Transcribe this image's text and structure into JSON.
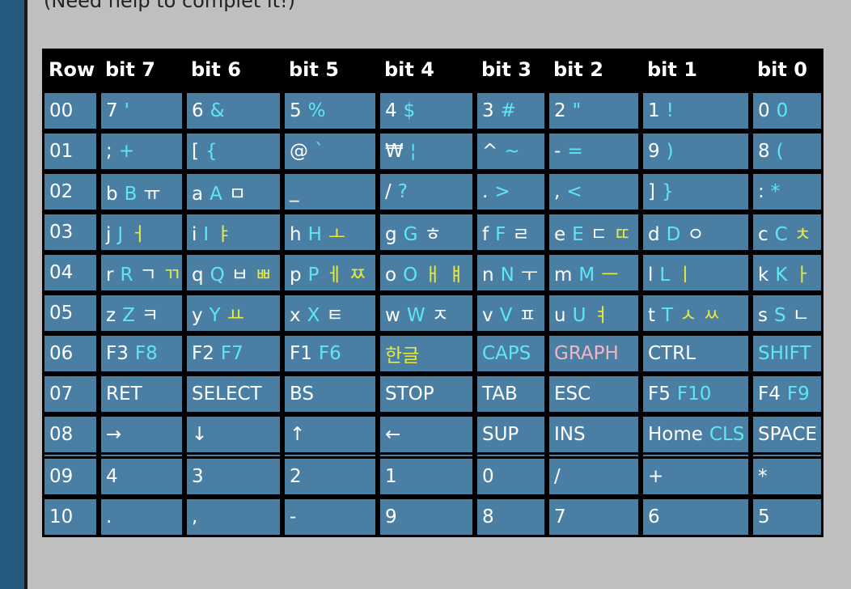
{
  "caption": "(Need help to complet it!)",
  "colors": {
    "white": "#ffffff",
    "cyan": "#5ee6f5",
    "yellow": "#e8ea3c",
    "pink": "#f4b4c4",
    "cell_bg": "#4a7fa3",
    "border": "#000000",
    "page_bg": "#bfbfbf"
  },
  "headers": [
    "Row",
    "bit 7",
    "bit 6",
    "bit 5",
    "bit 4",
    "bit 3",
    "bit 2",
    "bit 1",
    "bit 0"
  ],
  "rows": [
    {
      "row": "00",
      "cells": [
        [
          {
            "t": "7",
            "c": "white"
          },
          {
            "t": "'",
            "c": "cyan"
          }
        ],
        [
          {
            "t": "6",
            "c": "white"
          },
          {
            "t": "&",
            "c": "cyan"
          }
        ],
        [
          {
            "t": "5",
            "c": "white"
          },
          {
            "t": "%",
            "c": "cyan"
          }
        ],
        [
          {
            "t": "4",
            "c": "white"
          },
          {
            "t": "$",
            "c": "cyan"
          }
        ],
        [
          {
            "t": "3",
            "c": "white"
          },
          {
            "t": "#",
            "c": "cyan"
          }
        ],
        [
          {
            "t": "2",
            "c": "white"
          },
          {
            "t": "\"",
            "c": "cyan"
          }
        ],
        [
          {
            "t": "1",
            "c": "white"
          },
          {
            "t": "!",
            "c": "cyan"
          }
        ],
        [
          {
            "t": "0",
            "c": "white"
          },
          {
            "t": "0",
            "c": "cyan"
          }
        ]
      ]
    },
    {
      "row": "01",
      "cells": [
        [
          {
            "t": ";",
            "c": "white"
          },
          {
            "t": "+",
            "c": "cyan"
          }
        ],
        [
          {
            "t": "[",
            "c": "white"
          },
          {
            "t": "{",
            "c": "cyan"
          }
        ],
        [
          {
            "t": "@",
            "c": "white"
          },
          {
            "t": "`",
            "c": "cyan"
          }
        ],
        [
          {
            "t": "₩",
            "c": "white"
          },
          {
            "t": "¦",
            "c": "cyan"
          }
        ],
        [
          {
            "t": "^",
            "c": "white"
          },
          {
            "t": "~",
            "c": "cyan"
          }
        ],
        [
          {
            "t": "-",
            "c": "white"
          },
          {
            "t": "=",
            "c": "cyan"
          }
        ],
        [
          {
            "t": "9",
            "c": "white"
          },
          {
            "t": ")",
            "c": "cyan"
          }
        ],
        [
          {
            "t": "8",
            "c": "white"
          },
          {
            "t": "(",
            "c": "cyan"
          }
        ]
      ]
    },
    {
      "row": "02",
      "cells": [
        [
          {
            "t": "b",
            "c": "white"
          },
          {
            "t": "B",
            "c": "cyan"
          },
          {
            "t": "ㅠ",
            "c": "white"
          }
        ],
        [
          {
            "t": "a",
            "c": "white"
          },
          {
            "t": "A",
            "c": "cyan"
          },
          {
            "t": "ㅁ",
            "c": "white"
          }
        ],
        [
          {
            "t": "_",
            "c": "white"
          }
        ],
        [
          {
            "t": "/",
            "c": "white"
          },
          {
            "t": "?",
            "c": "cyan"
          }
        ],
        [
          {
            "t": ".",
            "c": "white"
          },
          {
            "t": ">",
            "c": "cyan"
          }
        ],
        [
          {
            "t": ",",
            "c": "white"
          },
          {
            "t": "<",
            "c": "cyan"
          }
        ],
        [
          {
            "t": "]",
            "c": "white"
          },
          {
            "t": "}",
            "c": "cyan"
          }
        ],
        [
          {
            "t": ":",
            "c": "white"
          },
          {
            "t": "*",
            "c": "cyan"
          }
        ]
      ]
    },
    {
      "row": "03",
      "cells": [
        [
          {
            "t": "j",
            "c": "white"
          },
          {
            "t": "J",
            "c": "cyan"
          },
          {
            "t": "ㅓ",
            "c": "yellow"
          }
        ],
        [
          {
            "t": "i",
            "c": "white"
          },
          {
            "t": "I",
            "c": "cyan"
          },
          {
            "t": "ㅑ",
            "c": "yellow"
          }
        ],
        [
          {
            "t": "h",
            "c": "white"
          },
          {
            "t": "H",
            "c": "cyan"
          },
          {
            "t": "ㅗ",
            "c": "yellow"
          }
        ],
        [
          {
            "t": "g",
            "c": "white"
          },
          {
            "t": "G",
            "c": "cyan"
          },
          {
            "t": "ㅎ",
            "c": "white"
          }
        ],
        [
          {
            "t": "f",
            "c": "white"
          },
          {
            "t": "F",
            "c": "cyan"
          },
          {
            "t": "ㄹ",
            "c": "white"
          }
        ],
        [
          {
            "t": "e",
            "c": "white"
          },
          {
            "t": "E",
            "c": "cyan"
          },
          {
            "t": "ㄷ",
            "c": "white"
          },
          {
            "t": "ㄸ",
            "c": "yellow"
          }
        ],
        [
          {
            "t": "d",
            "c": "white"
          },
          {
            "t": "D",
            "c": "cyan"
          },
          {
            "t": "ㅇ",
            "c": "white"
          }
        ],
        [
          {
            "t": "c",
            "c": "white"
          },
          {
            "t": "C",
            "c": "cyan"
          },
          {
            "t": "ㅊ",
            "c": "yellow"
          }
        ]
      ]
    },
    {
      "row": "04",
      "cells": [
        [
          {
            "t": "r",
            "c": "white"
          },
          {
            "t": "R",
            "c": "cyan"
          },
          {
            "t": "ㄱ",
            "c": "white"
          },
          {
            "t": "ㄲ",
            "c": "yellow"
          }
        ],
        [
          {
            "t": "q",
            "c": "white"
          },
          {
            "t": "Q",
            "c": "cyan"
          },
          {
            "t": "ㅂ",
            "c": "white"
          },
          {
            "t": "ㅃ",
            "c": "yellow"
          }
        ],
        [
          {
            "t": "p",
            "c": "white"
          },
          {
            "t": "P",
            "c": "cyan"
          },
          {
            "t": "ㅔ",
            "c": "yellow"
          },
          {
            "t": "ㅉ",
            "c": "yellow"
          }
        ],
        [
          {
            "t": "o",
            "c": "white"
          },
          {
            "t": "O",
            "c": "cyan"
          },
          {
            "t": "ㅐ",
            "c": "yellow"
          },
          {
            "t": "ㅒ",
            "c": "yellow"
          }
        ],
        [
          {
            "t": "n",
            "c": "white"
          },
          {
            "t": "N",
            "c": "cyan"
          },
          {
            "t": "ㅜ",
            "c": "white"
          }
        ],
        [
          {
            "t": "m",
            "c": "white"
          },
          {
            "t": "M",
            "c": "cyan"
          },
          {
            "t": "ㅡ",
            "c": "yellow"
          }
        ],
        [
          {
            "t": "l",
            "c": "white"
          },
          {
            "t": "L",
            "c": "cyan"
          },
          {
            "t": "ㅣ",
            "c": "yellow"
          }
        ],
        [
          {
            "t": "k",
            "c": "white"
          },
          {
            "t": "K",
            "c": "cyan"
          },
          {
            "t": "ㅏ",
            "c": "yellow"
          }
        ]
      ]
    },
    {
      "row": "05",
      "cells": [
        [
          {
            "t": "z",
            "c": "white"
          },
          {
            "t": "Z",
            "c": "cyan"
          },
          {
            "t": "ㅋ",
            "c": "white"
          }
        ],
        [
          {
            "t": "y",
            "c": "white"
          },
          {
            "t": "Y",
            "c": "cyan"
          },
          {
            "t": "ㅛ",
            "c": "yellow"
          }
        ],
        [
          {
            "t": "x",
            "c": "white"
          },
          {
            "t": "X",
            "c": "cyan"
          },
          {
            "t": "ㅌ",
            "c": "white"
          }
        ],
        [
          {
            "t": "w",
            "c": "white"
          },
          {
            "t": "W",
            "c": "cyan"
          },
          {
            "t": "ㅈ",
            "c": "white"
          }
        ],
        [
          {
            "t": "v",
            "c": "white"
          },
          {
            "t": "V",
            "c": "cyan"
          },
          {
            "t": "ㅍ",
            "c": "white"
          }
        ],
        [
          {
            "t": "u",
            "c": "white"
          },
          {
            "t": "U",
            "c": "cyan"
          },
          {
            "t": "ㅕ",
            "c": "yellow"
          }
        ],
        [
          {
            "t": "t",
            "c": "white"
          },
          {
            "t": "T",
            "c": "cyan"
          },
          {
            "t": "ㅅ",
            "c": "yellow"
          },
          {
            "t": "ㅆ",
            "c": "yellow"
          }
        ],
        [
          {
            "t": "s",
            "c": "white"
          },
          {
            "t": "S",
            "c": "cyan"
          },
          {
            "t": "ㄴ",
            "c": "white"
          }
        ]
      ]
    },
    {
      "row": "06",
      "cells": [
        [
          {
            "t": "F3",
            "c": "white"
          },
          {
            "t": "F8",
            "c": "cyan"
          }
        ],
        [
          {
            "t": "F2",
            "c": "white"
          },
          {
            "t": "F7",
            "c": "cyan"
          }
        ],
        [
          {
            "t": "F1",
            "c": "white"
          },
          {
            "t": "F6",
            "c": "cyan"
          }
        ],
        [
          {
            "t": "한글",
            "c": "yellow"
          }
        ],
        [
          {
            "t": "CAPS",
            "c": "cyan"
          }
        ],
        [
          {
            "t": "GRAPH",
            "c": "pink"
          }
        ],
        [
          {
            "t": "CTRL",
            "c": "white"
          }
        ],
        [
          {
            "t": "SHIFT",
            "c": "cyan"
          }
        ]
      ]
    },
    {
      "row": "07",
      "cells": [
        [
          {
            "t": "RET",
            "c": "white"
          }
        ],
        [
          {
            "t": "SELECT",
            "c": "white"
          }
        ],
        [
          {
            "t": "BS",
            "c": "white"
          }
        ],
        [
          {
            "t": "STOP",
            "c": "white"
          }
        ],
        [
          {
            "t": "TAB",
            "c": "white"
          }
        ],
        [
          {
            "t": "ESC",
            "c": "white"
          }
        ],
        [
          {
            "t": "F5",
            "c": "white"
          },
          {
            "t": "F10",
            "c": "cyan"
          }
        ],
        [
          {
            "t": "F4",
            "c": "white"
          },
          {
            "t": "F9",
            "c": "cyan"
          }
        ]
      ]
    },
    {
      "row": "08",
      "cells": [
        [
          {
            "t": "→",
            "c": "white"
          }
        ],
        [
          {
            "t": "↓",
            "c": "white"
          }
        ],
        [
          {
            "t": "↑",
            "c": "white"
          }
        ],
        [
          {
            "t": "←",
            "c": "white"
          }
        ],
        [
          {
            "t": "SUP",
            "c": "white"
          }
        ],
        [
          {
            "t": "INS",
            "c": "white"
          }
        ],
        [
          {
            "t": "Home",
            "c": "white"
          },
          {
            "t": "CLS",
            "c": "cyan"
          }
        ],
        [
          {
            "t": "SPACE",
            "c": "white"
          }
        ]
      ]
    },
    {
      "separator": true
    },
    {
      "row": "09",
      "cells": [
        [
          {
            "t": "4",
            "c": "white"
          }
        ],
        [
          {
            "t": "3",
            "c": "white"
          }
        ],
        [
          {
            "t": "2",
            "c": "white"
          }
        ],
        [
          {
            "t": "1",
            "c": "white"
          }
        ],
        [
          {
            "t": "0",
            "c": "white"
          }
        ],
        [
          {
            "t": "/",
            "c": "white"
          }
        ],
        [
          {
            "t": "+",
            "c": "white"
          }
        ],
        [
          {
            "t": "*",
            "c": "white"
          }
        ]
      ]
    },
    {
      "row": "10",
      "cells": [
        [
          {
            "t": ".",
            "c": "white"
          }
        ],
        [
          {
            "t": ",",
            "c": "white"
          }
        ],
        [
          {
            "t": "-",
            "c": "white"
          }
        ],
        [
          {
            "t": "9",
            "c": "white"
          }
        ],
        [
          {
            "t": "8",
            "c": "white"
          }
        ],
        [
          {
            "t": "7",
            "c": "white"
          }
        ],
        [
          {
            "t": "6",
            "c": "white"
          }
        ],
        [
          {
            "t": "5",
            "c": "white"
          }
        ]
      ]
    }
  ]
}
